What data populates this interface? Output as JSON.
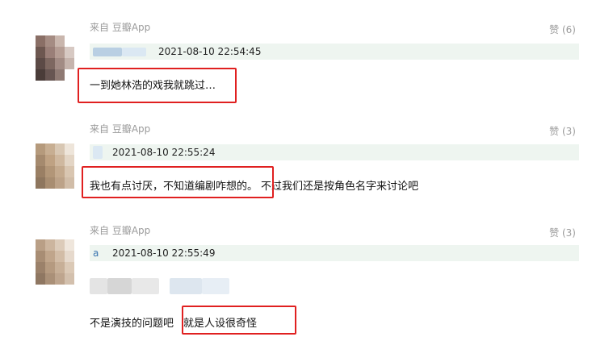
{
  "comments": [
    {
      "source": "来自 豆瓣App",
      "likes": "赞 (6)",
      "time": "2021-08-10 22:54:45",
      "username": "",
      "text": "一到她林浩的戏我就跳过…",
      "text_rest": ""
    },
    {
      "source": "来自 豆瓣App",
      "likes": "赞 (3)",
      "time": "2021-08-10 22:55:24",
      "username": "",
      "text": "我也有点讨厌，不知道编剧咋想的。",
      "text_rest": "不过我们还是按角色名字来讨论吧"
    },
    {
      "source": "来自 豆瓣App",
      "likes": "赞 (3)",
      "time": "2021-08-10 22:55:49",
      "username": "a",
      "text": "不是演技的问题吧",
      "text_rest": "就是人设很奇怪"
    }
  ],
  "colors": {
    "highlight": "#e02020",
    "meta_bg": "#eef5f0",
    "muted": "#9b9b9b"
  }
}
